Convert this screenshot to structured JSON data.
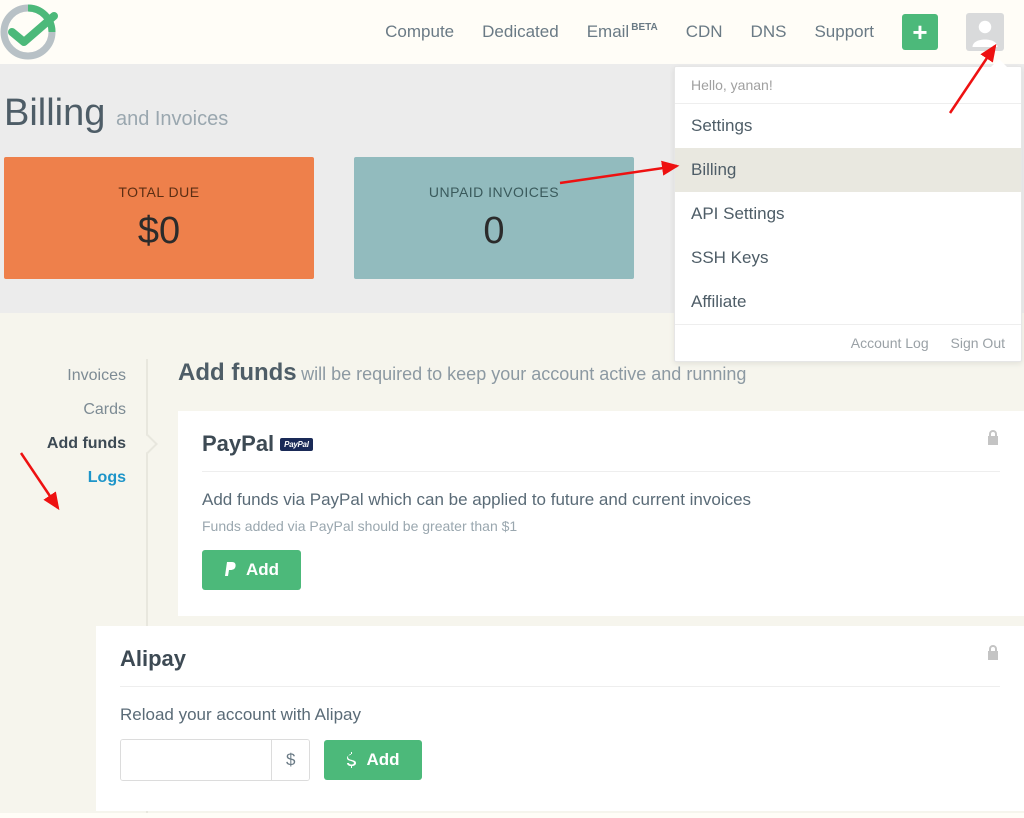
{
  "nav": {
    "compute": "Compute",
    "dedicated": "Dedicated",
    "email": "Email",
    "email_badge": "BETA",
    "cdn": "CDN",
    "dns": "DNS",
    "support": "Support"
  },
  "dropdown": {
    "hello": "Hello, yanan!",
    "settings": "Settings",
    "billing": "Billing",
    "api": "API Settings",
    "ssh": "SSH Keys",
    "affiliate": "Affiliate",
    "account_log": "Account Log",
    "sign_out": "Sign Out"
  },
  "hero": {
    "title": "Billing",
    "subtitle": "and Invoices",
    "total_due_label": "TOTAL DUE",
    "total_due_value": "$0",
    "unpaid_label": "UNPAID INVOICES",
    "unpaid_value": "0"
  },
  "sidebar": {
    "invoices": "Invoices",
    "cards": "Cards",
    "add_funds": "Add funds",
    "logs": "Logs"
  },
  "main": {
    "heading": "Add funds",
    "desc": "will be required to keep your account active and running"
  },
  "paypal": {
    "title": "PayPal",
    "badge": "PayPal",
    "desc": "Add funds via PayPal which can be applied to future and current invoices",
    "note": "Funds added via PayPal should be greater than $1",
    "add_btn": "Add"
  },
  "alipay": {
    "title": "Alipay",
    "desc": "Reload your account with Alipay",
    "currency": "$",
    "add_btn": "Add"
  }
}
